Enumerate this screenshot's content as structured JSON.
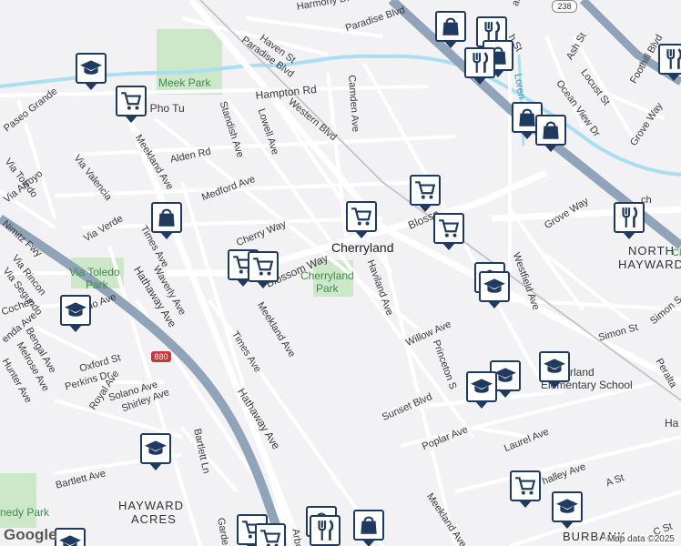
{
  "map": {
    "neighborhoods": {
      "cherryland": "Cherryland",
      "north_hayward_1": "NORTH",
      "north_hayward_2": "HAYWARD",
      "hayward_acres_1": "HAYWARD",
      "hayward_acres_2": "ACRES",
      "burbank": "BURBANK",
      "pua_pho_tu": "Pua Pho Tu"
    },
    "parks": {
      "meek": "Meek Park",
      "cherryland_1": "Cherryland",
      "cherryland_2": "Park",
      "via_toledo_1": "Via Toledo",
      "via_toledo_2": "Park",
      "kennedy": "nedy Park"
    },
    "school_label_1": "rland",
    "school_label_2": "Elementary School",
    "streets": {
      "harmony": "Harmony Dr",
      "haven": "Haven St",
      "paradise_blvd_1": "Paradise Blvd",
      "paradise_blvd_2": "Paradise Blvd",
      "mattox": "attox R",
      "ash": "Ash St",
      "locust": "Locust St",
      "ocean_view": "Ocean View Dr",
      "foothill": "Foothill Blvd",
      "grove_way_1": "Grove Way",
      "grove_way_2": "Grove Way",
      "hampton": "Hampton Rd",
      "camden": "Camden Ave",
      "western": "Western Blvd",
      "paseo_grande": "Paseo Grande",
      "standish": "Standish Ave",
      "lowell": "Lowell Ave",
      "alden": "Alden Rd",
      "via_toledo": "Via Toledo",
      "via_valencia": "Via Valencia",
      "meekland_1": "Meekland Ave",
      "meekland_2": "Meekland Ave",
      "meekland_3": "Meekland Ave",
      "medford": "Medford Ave",
      "via_arroyo": "Via Arroyo",
      "via_verde": "Via Verde",
      "nimitz": "Nimitz Fwy",
      "times_1": "Times Ave",
      "times_2": "Times Ave",
      "cherry_way": "Cherry Way",
      "blossom_1": "Blossom Way",
      "blossom_2": "Blosso",
      "haviland": "Haviland Ave",
      "westfield": "Westfield Ave",
      "via_rincon": "Via Rincon",
      "via_segundo": "Via Segundo",
      "waverly": "Waverly Ave",
      "hathaway_1": "Hathaway Ave",
      "hathaway_2": "Hathaway Ave",
      "coches": "Coches",
      "enda": "enda Ave",
      "bengal": "Bengal Ave",
      "melrose": "Melrose Ave",
      "hunter": "Hunter Ave",
      "oxford": "Oxford St",
      "perkins": "Perkins Dr",
      "solano": "Solano Ave",
      "royal": "Royal Ave",
      "shirley": "Shirley Ave",
      "willow": "Willow Ave",
      "princeton": "Princeton S",
      "simon_1": "Simon St",
      "simon_2": "Simon S",
      "peralta": "Peralta",
      "sunset": "Sunset Blvd",
      "poplar": "Poplar Ave",
      "laurel": "Laurel Ave",
      "bartlett_ln": "Bartlett Ln",
      "bartlett_ave": "Bartlett Ave",
      "whalley": "halley Ave",
      "a_st": "A St",
      "c_st": "C St",
      "gard": "Garde",
      "arbor": "Arbor",
      "lorenzo": "Loren",
      "ado": "ado Ave",
      "ha": "Ha",
      "cl": "Cl",
      "sch_st": "h St",
      "ch": "ch"
    },
    "route_238": "238",
    "route_880": "880",
    "logo": "Google",
    "attribution": "Map data ©2025"
  },
  "colors": {
    "background": "#f2f1f4",
    "road": "#ffffff",
    "freeway": "#8fa4b8",
    "park": "#cde8c8",
    "water": "#a9dff0",
    "pin_border": "#1f3a5f"
  },
  "icons": {
    "grocery": "shopping-cart-icon",
    "school": "graduation-cap-icon",
    "shopping": "shopping-bag-icon",
    "restaurant": "fork-knife-icon"
  }
}
